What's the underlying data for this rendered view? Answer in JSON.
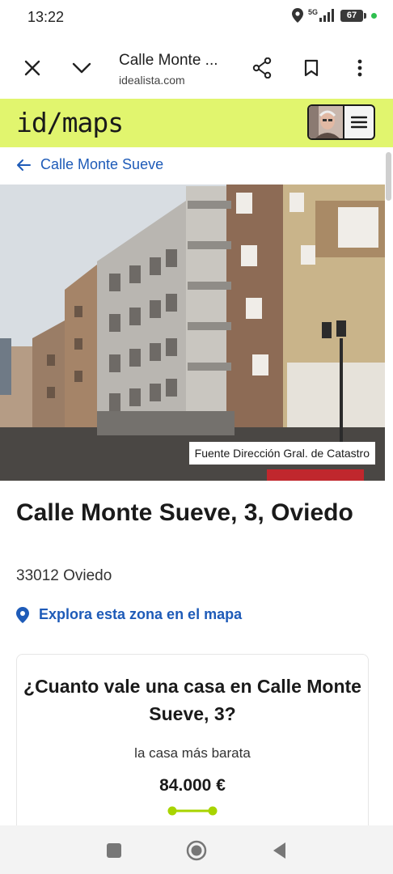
{
  "status": {
    "time": "13:22",
    "network": "5G",
    "battery": "67"
  },
  "browser": {
    "title": "Calle Monte ...",
    "domain": "idealista.com",
    "icons": [
      "close-icon",
      "chevron-down-icon",
      "share-icon",
      "bookmark-icon",
      "more-vert-icon"
    ]
  },
  "site": {
    "logo_id": "id",
    "logo_slash": "/",
    "logo_maps": "maps"
  },
  "back": {
    "label": "Calle Monte Sueve"
  },
  "photo": {
    "caption": "Fuente Dirección Gral. de Catastro"
  },
  "listing": {
    "title": "Calle Monte Sueve, 3, Oviedo",
    "postal": "33012 Oviedo",
    "explore_label": "Explora esta zona en el mapa"
  },
  "price_card": {
    "title": "¿Cuanto vale una casa en Calle Monte Sueve, 3?",
    "subtitle": "la casa más barata",
    "price": "84.000 €"
  },
  "colors": {
    "brand": "#e1f56e",
    "link": "#1e5bb8",
    "range": "#a8d400"
  }
}
